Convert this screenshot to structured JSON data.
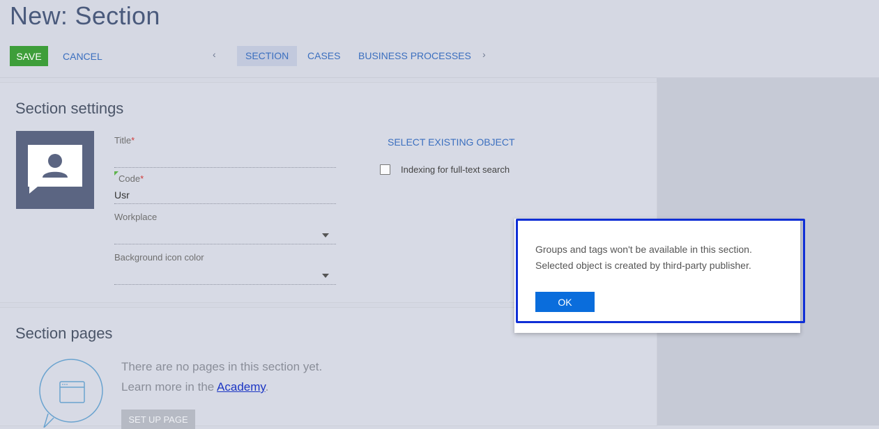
{
  "page": {
    "title": "New: Section"
  },
  "toolbar": {
    "save_label": "SAVE",
    "cancel_label": "CANCEL",
    "prev_icon": "chevron-left-icon",
    "next_icon": "chevron-right-icon",
    "tabs": [
      {
        "label": "SECTION",
        "active": true
      },
      {
        "label": "CASES",
        "active": false
      },
      {
        "label": "BUSINESS PROCESSES",
        "active": false
      }
    ]
  },
  "settings": {
    "heading": "Section settings",
    "image_icon": "user-chat-icon",
    "fields": {
      "title": {
        "label": "Title",
        "required": "*",
        "value": ""
      },
      "code": {
        "label": "Code",
        "required": "*",
        "value": "Usr"
      },
      "workplace": {
        "label": "Workplace",
        "value": ""
      },
      "background_icon_color": {
        "label": "Background icon color",
        "value": ""
      }
    },
    "select_existing_label": "SELECT EXISTING OBJECT",
    "indexing": {
      "label": "Indexing for full-text search",
      "checked": false
    }
  },
  "pages": {
    "heading": "Section pages",
    "empty_icon": "browser-window-chat-icon",
    "empty_line1": "There are no pages in this section yet.",
    "empty_line2_prefix": "Learn more in the ",
    "academy_link": "Academy",
    "empty_line2_suffix": ".",
    "setup_button": "SET UP PAGE"
  },
  "dialog": {
    "line1": "Groups and tags won't be available in this section.",
    "line2": "Selected object is created by third-party publisher.",
    "ok_label": "OK"
  },
  "colors": {
    "save_green": "#3e9e3a",
    "link_blue": "#3b6fbf",
    "ok_blue": "#0a6ddc",
    "highlight_border": "#0f2fd6",
    "image_bg": "#5b6582"
  }
}
